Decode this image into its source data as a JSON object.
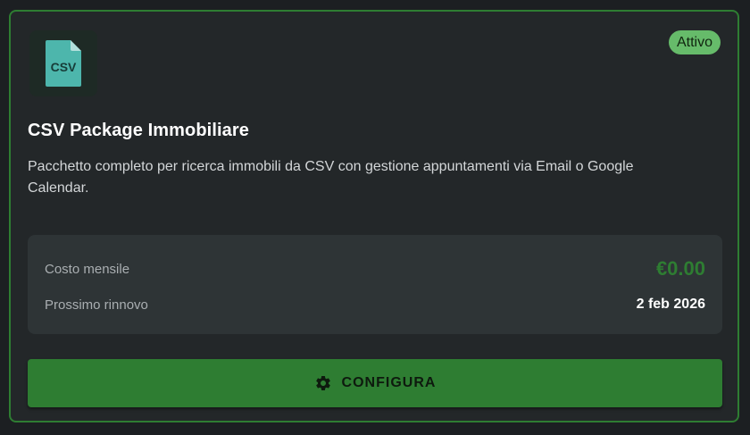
{
  "card": {
    "icon": "csv-file-icon",
    "icon_text": "CSV",
    "status": "Attivo",
    "title": "CSV Package Immobiliare",
    "description": "Pacchetto completo per ricerca immobili da CSV con gestione appuntamenti via Email o Google Calendar.",
    "details": {
      "cost_label": "Costo mensile",
      "cost_value": "€0.00",
      "renewal_label": "Prossimo rinnovo",
      "renewal_value": "2 feb 2026"
    },
    "action": {
      "icon": "gear-icon",
      "label": "CONFIGURA"
    }
  },
  "colors": {
    "accent": "#2e7d32",
    "badge": "#66bb6a",
    "file_icon": "#4db6ac",
    "background": "#232729"
  }
}
